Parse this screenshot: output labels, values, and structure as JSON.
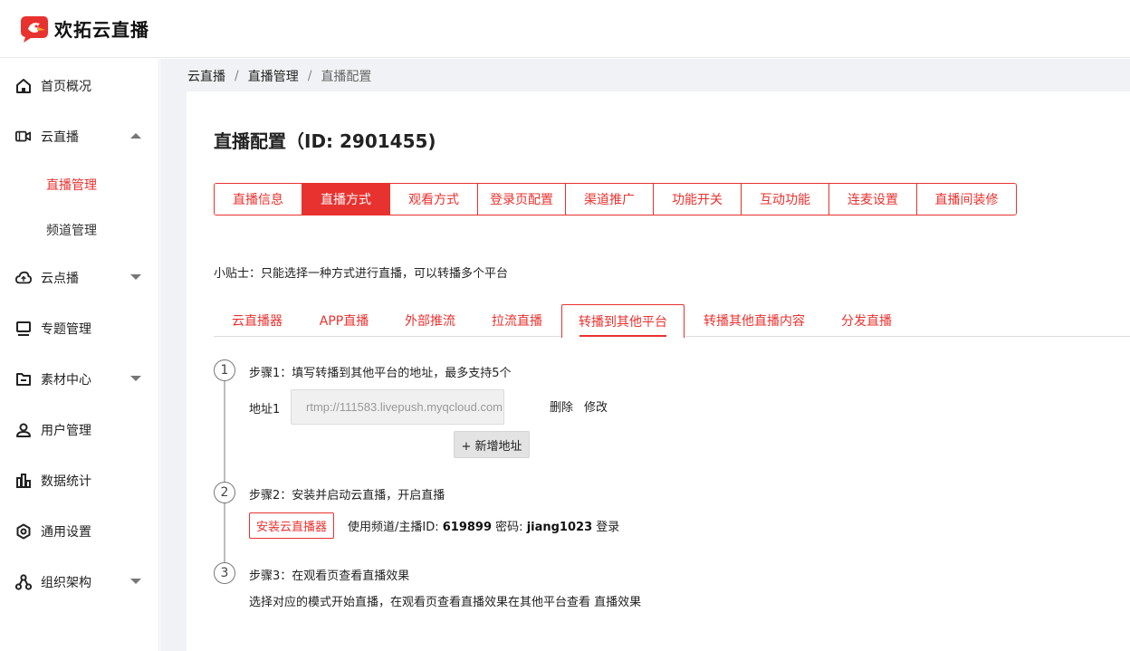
{
  "brand": {
    "name": "欢拓云直播",
    "color": "#e8322f"
  },
  "sidebar": {
    "items": [
      {
        "label": "首页概况",
        "icon": "home-icon"
      },
      {
        "label": "云直播",
        "icon": "video-camera-icon"
      },
      {
        "label": "云点播",
        "icon": "cloud-icon"
      },
      {
        "label": "专题管理",
        "icon": "monitor-icon"
      },
      {
        "label": "素材中心",
        "icon": "folder-icon"
      },
      {
        "label": "用户管理",
        "icon": "user-icon"
      },
      {
        "label": "数据统计",
        "icon": "bar-chart-icon"
      },
      {
        "label": "通用设置",
        "icon": "settings-icon"
      },
      {
        "label": "组织架构",
        "icon": "org-chart-icon"
      }
    ],
    "sub_items": [
      {
        "label": "直播管理"
      },
      {
        "label": "频道管理"
      }
    ]
  },
  "breadcrumb": {
    "items": [
      "云直播",
      "直播管理",
      "直播配置"
    ],
    "separator": "/"
  },
  "page": {
    "title": "直播配置（ID: 2901455)"
  },
  "tabs": [
    "直播信息",
    "直播方式",
    "观看方式",
    "登录页配置",
    "渠道推广",
    "功能开关",
    "互动功能",
    "连麦设置",
    "直播间装修"
  ],
  "active_tab": "直播方式",
  "tip": "小贴士：只能选择一种方式进行直播，可以转播多个平台",
  "subtabs": [
    "云直播器",
    "APP直播",
    "外部推流",
    "拉流直播",
    "转播到其他平台",
    "转播其他直播内容",
    "分发直播"
  ],
  "active_subtab": "转播到其他平台",
  "steps": [
    {
      "num": "1",
      "title": "步骤1：填写转播到其他平台的地址，最多支持5个"
    },
    {
      "num": "2",
      "title": "步骤2：安装并启动云直播，开启直播"
    },
    {
      "num": "3",
      "title": "步骤3：在观看页查看直播效果"
    }
  ],
  "address": {
    "label": "地址1",
    "value": "rtmp://111583.livepush.myqcloud.com",
    "delete_label": "删除",
    "edit_label": "修改",
    "add_label": "+ 新增地址"
  },
  "install": {
    "button_label": "安装云直播器",
    "channel_prefix": "使用频道/主播ID: ",
    "channel_id": "619899",
    "password_prefix": " 密码: ",
    "password": "jiang1023",
    "login_label": " 登录"
  },
  "step3_desc": "选择对应的模式开始直播，在观看页查看直播效果在其他平台查看 直播效果"
}
